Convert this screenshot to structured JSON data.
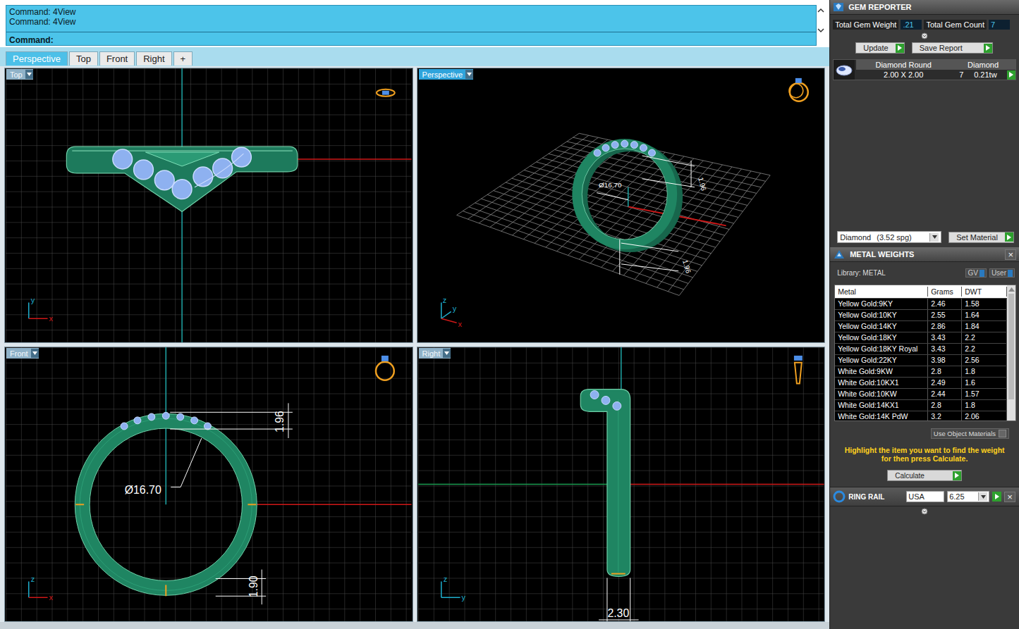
{
  "command_line": {
    "history": [
      "Command: 4View",
      "Command: 4View"
    ],
    "prompt": "Command:"
  },
  "tabs": [
    {
      "label": "Perspective",
      "selected": true
    },
    {
      "label": "Top",
      "selected": false
    },
    {
      "label": "Front",
      "selected": false
    },
    {
      "label": "Right",
      "selected": false
    },
    {
      "label": "+",
      "selected": false
    }
  ],
  "viewports": {
    "top": {
      "label": "Top",
      "active": false,
      "axes": [
        "y",
        "x"
      ]
    },
    "perspective": {
      "label": "Perspective",
      "active": true,
      "axes": [
        "z",
        "y",
        "x"
      ],
      "dimensions": {
        "inner_diameter": "Ø16.70",
        "height_top": "1.96",
        "height_bottom": "1.96"
      }
    },
    "front": {
      "label": "Front",
      "active": false,
      "axes": [
        "z",
        "x"
      ],
      "dimensions": {
        "height_top": "1.96",
        "inner_diameter": "Ø16.70",
        "height_bottom": "1.90"
      }
    },
    "right": {
      "label": "Right",
      "active": false,
      "axes": [
        "z",
        "y"
      ],
      "dimensions": {
        "width": "2.30"
      }
    }
  },
  "gem_reporter": {
    "title": "GEM REPORTER",
    "total_weight_label": "Total Gem Weight",
    "total_weight": ".21",
    "total_count_label": "Total Gem Count",
    "total_count": "7",
    "update_button": "Update",
    "save_button": "Save Report",
    "gems": [
      {
        "shape": "Diamond Round",
        "size": "2.00 X 2.00",
        "material": "Diamond",
        "count": "7",
        "weight": "0.21tw"
      }
    ],
    "material_name": "Diamond",
    "material_density": "(3.52 spg)",
    "set_material_button": "Set Material"
  },
  "metal_weights": {
    "title": "METAL WEIGHTS",
    "close": "×",
    "library": "Library: METAL",
    "gv_label": "GV",
    "gv_on": true,
    "user_label": "User",
    "user_on": true,
    "columns": [
      "Metal",
      "Grams",
      "DWT"
    ],
    "rows": [
      [
        "Yellow Gold:9KY",
        "2.46",
        "1.58"
      ],
      [
        "Yellow Gold:10KY",
        "2.55",
        "1.64"
      ],
      [
        "Yellow Gold:14KY",
        "2.86",
        "1.84"
      ],
      [
        "Yellow Gold:18KY",
        "3.43",
        "2.2"
      ],
      [
        "Yellow Gold:18KY Royal",
        "3.43",
        "2.2"
      ],
      [
        "Yellow Gold:22KY",
        "3.98",
        "2.56"
      ],
      [
        "White Gold:9KW",
        "2.8",
        "1.8"
      ],
      [
        "White Gold:10KX1",
        "2.49",
        "1.6"
      ],
      [
        "White Gold:10KW",
        "2.44",
        "1.57"
      ],
      [
        "White Gold:14KX1",
        "2.8",
        "1.8"
      ],
      [
        "White Gold:14K PdW",
        "3.2",
        "2.06"
      ]
    ],
    "use_object_materials": "Use Object Materials",
    "use_object_checked": false,
    "hint": "Highlight the item you want to find the weight for then press Calculate.",
    "calculate_button": "Calculate"
  },
  "ring_rail": {
    "title": "RING RAIL",
    "close": "×",
    "system": "USA",
    "size": "6.25"
  }
}
